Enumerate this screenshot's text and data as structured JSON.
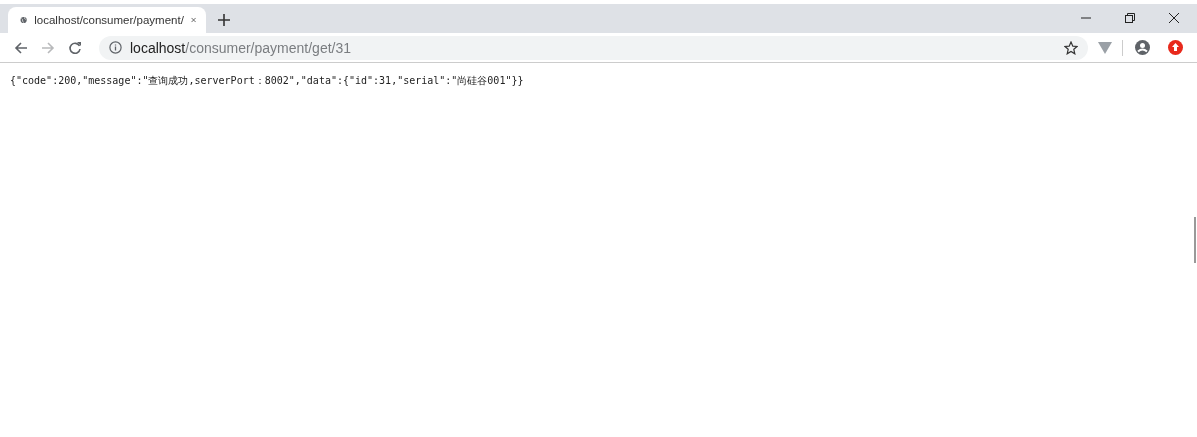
{
  "tabs": [
    {
      "title": "localhost/consumer/payment/",
      "selected": true
    }
  ],
  "address": {
    "host": "localhost",
    "path": "/consumer/payment/get/31"
  },
  "page": {
    "text": "{\"code\":200,\"message\":\"查询成功,serverPort：8002\",\"data\":{\"id\":31,\"serial\":\"尚硅谷001\"}}"
  }
}
